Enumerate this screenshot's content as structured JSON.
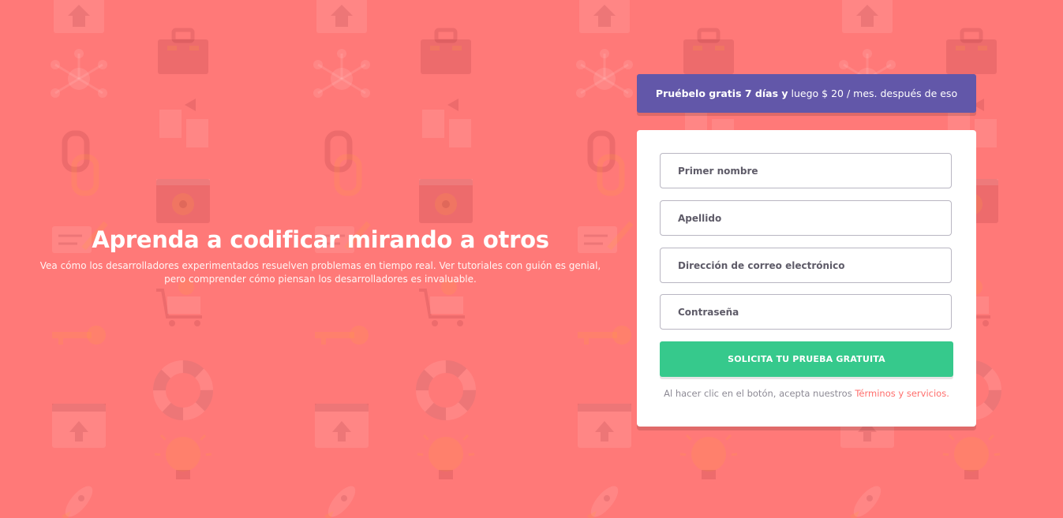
{
  "theme": {
    "background": "#ff7978",
    "banner": "#6257a9",
    "button": "#36c98c",
    "link": "#ff6e6c"
  },
  "hero": {
    "title": "Aprenda a codificar mirando a otros",
    "description_line1": "Vea cómo los desarrolladores experimentados resuelven problemas en tiempo real. Ver tutoriales con guión es genial,",
    "description_line2": "pero comprender cómo piensan los desarrolladores es invaluable."
  },
  "offer": {
    "bold": "Pruébelo gratis 7 días y",
    "rest": "luego $ 20 / mes. después de eso"
  },
  "form": {
    "first_name_placeholder": "Primer nombre",
    "last_name_placeholder": "Apellido",
    "email_placeholder": "Dirección de correo electrónico",
    "password_placeholder": "Contraseña",
    "submit_label": "SOLICITA TU PRUEBA GRATUITA",
    "terms_text": "Al hacer clic en el botón, acepta nuestros",
    "terms_link": "Términos y servicios."
  },
  "background_icons": [
    "house-icon",
    "toolbox-icon",
    "network-icon",
    "documents-icon",
    "link-icon",
    "gear-window-icon",
    "pencil-card-icon",
    "cart-icon",
    "key-icon",
    "lifebuoy-icon",
    "browser-upload-icon",
    "lightbulb-icon",
    "rocket-icon"
  ]
}
